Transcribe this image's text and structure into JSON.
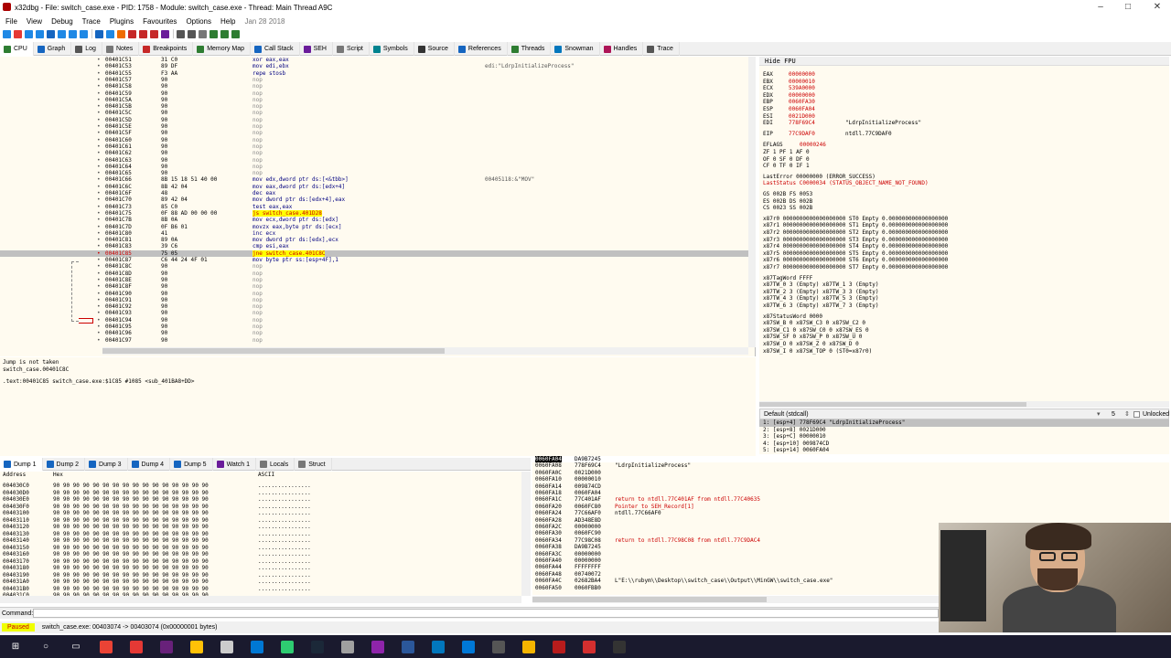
{
  "window": {
    "title": "x32dbg - File: switch_case.exe - PID: 1758 - Module: switch_case.exe - Thread: Main Thread A9C"
  },
  "menu": [
    "File",
    "View",
    "Debug",
    "Trace",
    "Plugins",
    "Favourites",
    "Options",
    "Help",
    "Jan 28 2018"
  ],
  "tabs": [
    {
      "label": "CPU",
      "color": "#2e7d32"
    },
    {
      "label": "Graph",
      "color": "#1565c0"
    },
    {
      "label": "Log",
      "color": "#555"
    },
    {
      "label": "Notes",
      "color": "#777"
    },
    {
      "label": "Breakpoints",
      "color": "#c62828"
    },
    {
      "label": "Memory Map",
      "color": "#2e7d32"
    },
    {
      "label": "Call Stack",
      "color": "#1565c0"
    },
    {
      "label": "SEH",
      "color": "#6a1b9a"
    },
    {
      "label": "Script",
      "color": "#777"
    },
    {
      "label": "Symbols",
      "color": "#00838f"
    },
    {
      "label": "Source",
      "color": "#333"
    },
    {
      "label": "References",
      "color": "#1565c0"
    },
    {
      "label": "Threads",
      "color": "#2e7d32"
    },
    {
      "label": "Snowman",
      "color": "#0277bd"
    },
    {
      "label": "Handles",
      "color": "#ad1457"
    },
    {
      "label": "Trace",
      "color": "#555"
    }
  ],
  "disasm": [
    {
      "addr": "00401C51",
      "bytes": "31 C0",
      "instr": "xor eax,eax",
      "comment": ""
    },
    {
      "addr": "00401C53",
      "bytes": "89 DF",
      "instr": "mov edi,ebx",
      "comment": "edi:\"LdrpInitializeProcess\""
    },
    {
      "addr": "00401C55",
      "bytes": "F3 AA",
      "instr": "repe stosb",
      "comment": ""
    },
    {
      "addr": "00401C57",
      "bytes": "90",
      "instr": "nop",
      "comment": ""
    },
    {
      "addr": "00401C58",
      "bytes": "90",
      "instr": "nop",
      "comment": ""
    },
    {
      "addr": "00401C59",
      "bytes": "90",
      "instr": "nop",
      "comment": ""
    },
    {
      "addr": "00401C5A",
      "bytes": "90",
      "instr": "nop",
      "comment": ""
    },
    {
      "addr": "00401C5B",
      "bytes": "90",
      "instr": "nop",
      "comment": ""
    },
    {
      "addr": "00401C5C",
      "bytes": "90",
      "instr": "nop",
      "comment": ""
    },
    {
      "addr": "00401C5D",
      "bytes": "90",
      "instr": "nop",
      "comment": ""
    },
    {
      "addr": "00401C5E",
      "bytes": "90",
      "instr": "nop",
      "comment": ""
    },
    {
      "addr": "00401C5F",
      "bytes": "90",
      "instr": "nop",
      "comment": ""
    },
    {
      "addr": "00401C60",
      "bytes": "90",
      "instr": "nop",
      "comment": ""
    },
    {
      "addr": "00401C61",
      "bytes": "90",
      "instr": "nop",
      "comment": ""
    },
    {
      "addr": "00401C62",
      "bytes": "90",
      "instr": "nop",
      "comment": ""
    },
    {
      "addr": "00401C63",
      "bytes": "90",
      "instr": "nop",
      "comment": ""
    },
    {
      "addr": "00401C64",
      "bytes": "90",
      "instr": "nop",
      "comment": ""
    },
    {
      "addr": "00401C65",
      "bytes": "90",
      "instr": "nop",
      "comment": ""
    },
    {
      "addr": "00401C66",
      "bytes": "8B 15 18 51 40 00",
      "instr": "mov edx,dword ptr ds:[<&tbb>]",
      "comment": "00405118:&\"MOV\""
    },
    {
      "addr": "00401C6C",
      "bytes": "8B 42 04",
      "instr": "mov eax,dword ptr ds:[edx+4]",
      "comment": ""
    },
    {
      "addr": "00401C6F",
      "bytes": "48",
      "instr": "dec eax",
      "comment": ""
    },
    {
      "addr": "00401C70",
      "bytes": "89 42 04",
      "instr": "mov dword ptr ds:[edx+4],eax",
      "comment": ""
    },
    {
      "addr": "00401C73",
      "bytes": "85 C0",
      "instr": "test eax,eax",
      "comment": ""
    },
    {
      "addr": "00401C75",
      "bytes": "0F 88 AD 00 00 00",
      "instr": "js switch_case.401D28",
      "comment": ""
    },
    {
      "addr": "00401C7B",
      "bytes": "8B 0A",
      "instr": "mov ecx,dword ptr ds:[edx]",
      "comment": ""
    },
    {
      "addr": "00401C7D",
      "bytes": "0F B6 01",
      "instr": "movzx eax,byte ptr ds:[ecx]",
      "comment": ""
    },
    {
      "addr": "00401C80",
      "bytes": "41",
      "instr": "inc ecx",
      "comment": ""
    },
    {
      "addr": "00401C81",
      "bytes": "89 0A",
      "instr": "mov dword ptr ds:[edx],ecx",
      "comment": ""
    },
    {
      "addr": "00401C83",
      "bytes": "39 C6",
      "instr": "cmp esi,eax",
      "comment": ""
    },
    {
      "addr": "00401C85",
      "bytes": "75 05",
      "instr": "jne switch_case.401C8C",
      "comment": ""
    },
    {
      "addr": "00401C87",
      "bytes": "C6 44 24 4F 01",
      "instr": "mov byte ptr ss:[esp+4F],1",
      "comment": ""
    },
    {
      "addr": "00401C8C",
      "bytes": "90",
      "instr": "nop",
      "comment": ""
    },
    {
      "addr": "00401C8D",
      "bytes": "90",
      "instr": "nop",
      "comment": ""
    },
    {
      "addr": "00401C8E",
      "bytes": "90",
      "instr": "nop",
      "comment": ""
    },
    {
      "addr": "00401C8F",
      "bytes": "90",
      "instr": "nop",
      "comment": ""
    },
    {
      "addr": "00401C90",
      "bytes": "90",
      "instr": "nop",
      "comment": ""
    },
    {
      "addr": "00401C91",
      "bytes": "90",
      "instr": "nop",
      "comment": ""
    },
    {
      "addr": "00401C92",
      "bytes": "90",
      "instr": "nop",
      "comment": ""
    },
    {
      "addr": "00401C93",
      "bytes": "90",
      "instr": "nop",
      "comment": ""
    },
    {
      "addr": "00401C94",
      "bytes": "90",
      "instr": "nop",
      "comment": ""
    },
    {
      "addr": "00401C95",
      "bytes": "90",
      "instr": "nop",
      "comment": ""
    },
    {
      "addr": "00401C96",
      "bytes": "90",
      "instr": "nop",
      "comment": ""
    },
    {
      "addr": "00401C97",
      "bytes": "90",
      "instr": "nop",
      "comment": ""
    }
  ],
  "info": {
    "line1": "Jump is not taken",
    "line2": "switch_case.00401C8C",
    "line3": ".text:00401C85 switch_case.exe:$1C85 #1085 <sub_401BA8+DD>"
  },
  "registers": {
    "header": "Hide FPU",
    "gp": [
      {
        "name": "EAX",
        "value": "00000000",
        "note": ""
      },
      {
        "name": "EBX",
        "value": "00000010",
        "note": ""
      },
      {
        "name": "ECX",
        "value": "539A0000",
        "note": ""
      },
      {
        "name": "EDX",
        "value": "00000000",
        "note": ""
      },
      {
        "name": "EBP",
        "value": "0060FA30",
        "note": ""
      },
      {
        "name": "ESP",
        "value": "0060FA04",
        "note": ""
      },
      {
        "name": "ESI",
        "value": "0021D000",
        "note": ""
      },
      {
        "name": "EDI",
        "value": "778F69C4",
        "note": "\"LdrpInitializeProcess\""
      }
    ],
    "eip": {
      "name": "EIP",
      "value": "77C9DAF0",
      "note": "ntdll.77C9DAF0"
    },
    "eflags": {
      "name": "EFLAGS",
      "value": "00000246"
    },
    "flags": [
      "ZF 1  PF 1  AF 0",
      "OF 0  SF 0  DF 0",
      "CF 0  TF 0  IF 1"
    ],
    "lasterror": "LastError  00000000 (ERROR_SUCCESS)",
    "laststatus": "LastStatus C0000034 (STATUS_OBJECT_NAME_NOT_FOUND)",
    "segs": [
      "GS 002B  FS 0053",
      "ES 002B  DS 002B",
      "CS 0023  SS 002B"
    ],
    "fpu": [
      "x87r0 0000000000000000000 ST0 Empty 0.000000000000000000",
      "x87r1 0000000000000000000 ST1 Empty 0.000000000000000000",
      "x87r2 0000000000000000000 ST2 Empty 0.000000000000000000",
      "x87r3 0000000000000000000 ST3 Empty 0.000000000000000000",
      "x87r4 0000000000000000000 ST4 Empty 0.000000000000000000",
      "x87r5 0000000000000000000 ST5 Empty 0.000000000000000000",
      "x87r6 0000000000000000000 ST6 Empty 0.000000000000000000",
      "x87r7 0000000000000000000 ST7 Empty 0.000000000000000000"
    ],
    "tagword": [
      "x87TagWord FFFF",
      "x87TW_0 3 (Empty)    x87TW_1 3 (Empty)",
      "x87TW_2 3 (Empty)    x87TW_3 3 (Empty)",
      "x87TW_4 3 (Empty)    x87TW_5 3 (Empty)",
      "x87TW_6 3 (Empty)    x87TW_7 3 (Empty)"
    ],
    "statusword": [
      "x87StatusWord 0000",
      "x87SW_B  0  x87SW_C3 0  x87SW_C2 0",
      "x87SW_C1 0  x87SW_C0 0  x87SW_ES 0",
      "x87SW_SF 0  x87SW_P  0  x87SW_U  0",
      "x87SW_O  0  x87SW_Z  0  x87SW_D  0",
      "x87SW_I  0  x87SW_TOP 0 (ST0=x87r0)"
    ]
  },
  "callconv": {
    "label": "Default (stdcall)",
    "count": "5",
    "unlocked": "Unlocked"
  },
  "args": [
    "1: [esp+4] 778F69C4 \"LdrpInitializeProcess\"",
    "2: [esp+8] 0021D000",
    "3: [esp+C] 00000010",
    "4: [esp+10] 009874CD",
    "5: [esp+14] 0060FA04"
  ],
  "dumptabs": [
    "Dump 1",
    "Dump 2",
    "Dump 3",
    "Dump 4",
    "Dump 5",
    "Watch 1",
    "Locals",
    "Struct"
  ],
  "dump": {
    "h_addr": "Address",
    "h_hex": "Hex",
    "h_ascii": "ASCII",
    "rows": [
      {
        "addr": "004030C0",
        "hex": "90 90 90 90 90 90 90 90 90 90 90 90 90 90 90 90",
        "ascii": "................"
      },
      {
        "addr": "004030D0",
        "hex": "90 90 90 90 90 90 90 90 90 90 90 90 90 90 90 90",
        "ascii": "................"
      },
      {
        "addr": "004030E0",
        "hex": "90 90 90 90 90 90 90 90 90 90 90 90 90 90 90 90",
        "ascii": "................"
      },
      {
        "addr": "004030F0",
        "hex": "90 90 90 90 90 90 90 90 90 90 90 90 90 90 90 90",
        "ascii": "................"
      },
      {
        "addr": "00403100",
        "hex": "90 90 90 90 90 90 90 90 90 90 90 90 90 90 90 90",
        "ascii": "................"
      },
      {
        "addr": "00403110",
        "hex": "90 90 90 90 90 90 90 90 90 90 90 90 90 90 90 90",
        "ascii": "................"
      },
      {
        "addr": "00403120",
        "hex": "90 90 90 90 90 90 90 90 90 90 90 90 90 90 90 90",
        "ascii": "................"
      },
      {
        "addr": "00403130",
        "hex": "90 90 90 90 90 90 90 90 90 90 90 90 90 90 90 90",
        "ascii": "................"
      },
      {
        "addr": "00403140",
        "hex": "90 90 90 90 90 90 90 90 90 90 90 90 90 90 90 90",
        "ascii": "................"
      },
      {
        "addr": "00403150",
        "hex": "90 90 90 90 90 90 90 90 90 90 90 90 90 90 90 90",
        "ascii": "................"
      },
      {
        "addr": "00403160",
        "hex": "90 90 90 90 90 90 90 90 90 90 90 90 90 90 90 90",
        "ascii": "................"
      },
      {
        "addr": "00403170",
        "hex": "90 90 90 90 90 90 90 90 90 90 90 90 90 90 90 90",
        "ascii": "................"
      },
      {
        "addr": "00403180",
        "hex": "90 90 90 90 90 90 90 90 90 90 90 90 90 90 90 90",
        "ascii": "................"
      },
      {
        "addr": "00403190",
        "hex": "90 90 90 90 90 90 90 90 90 90 90 90 90 90 90 90",
        "ascii": "................"
      },
      {
        "addr": "004031A0",
        "hex": "90 90 90 90 90 90 90 90 90 90 90 90 90 90 90 90",
        "ascii": "................"
      },
      {
        "addr": "004031B0",
        "hex": "90 90 90 90 90 90 90 90 90 90 90 90 90 90 90 90",
        "ascii": "................"
      },
      {
        "addr": "004031C0",
        "hex": "90 90 90 90 90 90 90 90 90 90 90 90 90 90 90 90",
        "ascii": "................"
      }
    ]
  },
  "stack": [
    {
      "addr": "0060FA04",
      "val": "DA9B7245",
      "cmt": ""
    },
    {
      "addr": "0060FA08",
      "val": "778F69C4",
      "cmt": "\"LdrpInitializeProcess\""
    },
    {
      "addr": "0060FA0C",
      "val": "0021D000",
      "cmt": ""
    },
    {
      "addr": "0060FA10",
      "val": "00000010",
      "cmt": ""
    },
    {
      "addr": "0060FA14",
      "val": "009874CD",
      "cmt": ""
    },
    {
      "addr": "0060FA18",
      "val": "0060FA04",
      "cmt": ""
    },
    {
      "addr": "0060FA1C",
      "val": "77C401AF",
      "cmt": "return to ntdll.77C401AF from ntdll.77C40635"
    },
    {
      "addr": "0060FA20",
      "val": "0060FC80",
      "cmt": "Pointer to SEH_Record[1]"
    },
    {
      "addr": "0060FA24",
      "val": "77C66AF0",
      "cmt": "ntdll.77C66AF0"
    },
    {
      "addr": "0060FA28",
      "val": "AD348E8D",
      "cmt": ""
    },
    {
      "addr": "0060FA2C",
      "val": "00000000",
      "cmt": ""
    },
    {
      "addr": "0060FA30",
      "val": "0060FC90",
      "cmt": ""
    },
    {
      "addr": "0060FA34",
      "val": "77C98C08",
      "cmt": "return to ntdll.77C98C08 from ntdll.77C9DAC4"
    },
    {
      "addr": "0060FA38",
      "val": "DA9B7245",
      "cmt": ""
    },
    {
      "addr": "0060FA3C",
      "val": "00000000",
      "cmt": ""
    },
    {
      "addr": "0060FA40",
      "val": "00000000",
      "cmt": ""
    },
    {
      "addr": "0060FA44",
      "val": "FFFFFFFF",
      "cmt": ""
    },
    {
      "addr": "0060FA48",
      "val": "00740072",
      "cmt": ""
    },
    {
      "addr": "0060FA4C",
      "val": "02682BA4",
      "cmt": "L\"E:\\\\rubym\\\\Desktop\\\\switch_case\\\\Output\\\\MinGW\\\\switch_case.exe\""
    },
    {
      "addr": "0060FA50",
      "val": "0060FBB0",
      "cmt": ""
    }
  ],
  "command": {
    "label": "Command:",
    "value": ""
  },
  "status": {
    "state": "Paused",
    "text": "switch_case.exe: 00403074 -> 00403074 (0x00000001 bytes)"
  },
  "taskbar_icons": [
    "windows-icon",
    "search-icon",
    "taskview-icon",
    "chrome-icon",
    "record-icon",
    "vs-icon",
    "explorer-icon",
    "terminal-icon",
    "vscode-icon",
    "camtasia-icon",
    "steam-icon",
    "app-icon",
    "ida-icon",
    "word-icon",
    "notepad-icon",
    "edge-icon",
    "calc-icon",
    "files-icon",
    "x64dbg-icon",
    "red-icon",
    "cmd-icon"
  ]
}
